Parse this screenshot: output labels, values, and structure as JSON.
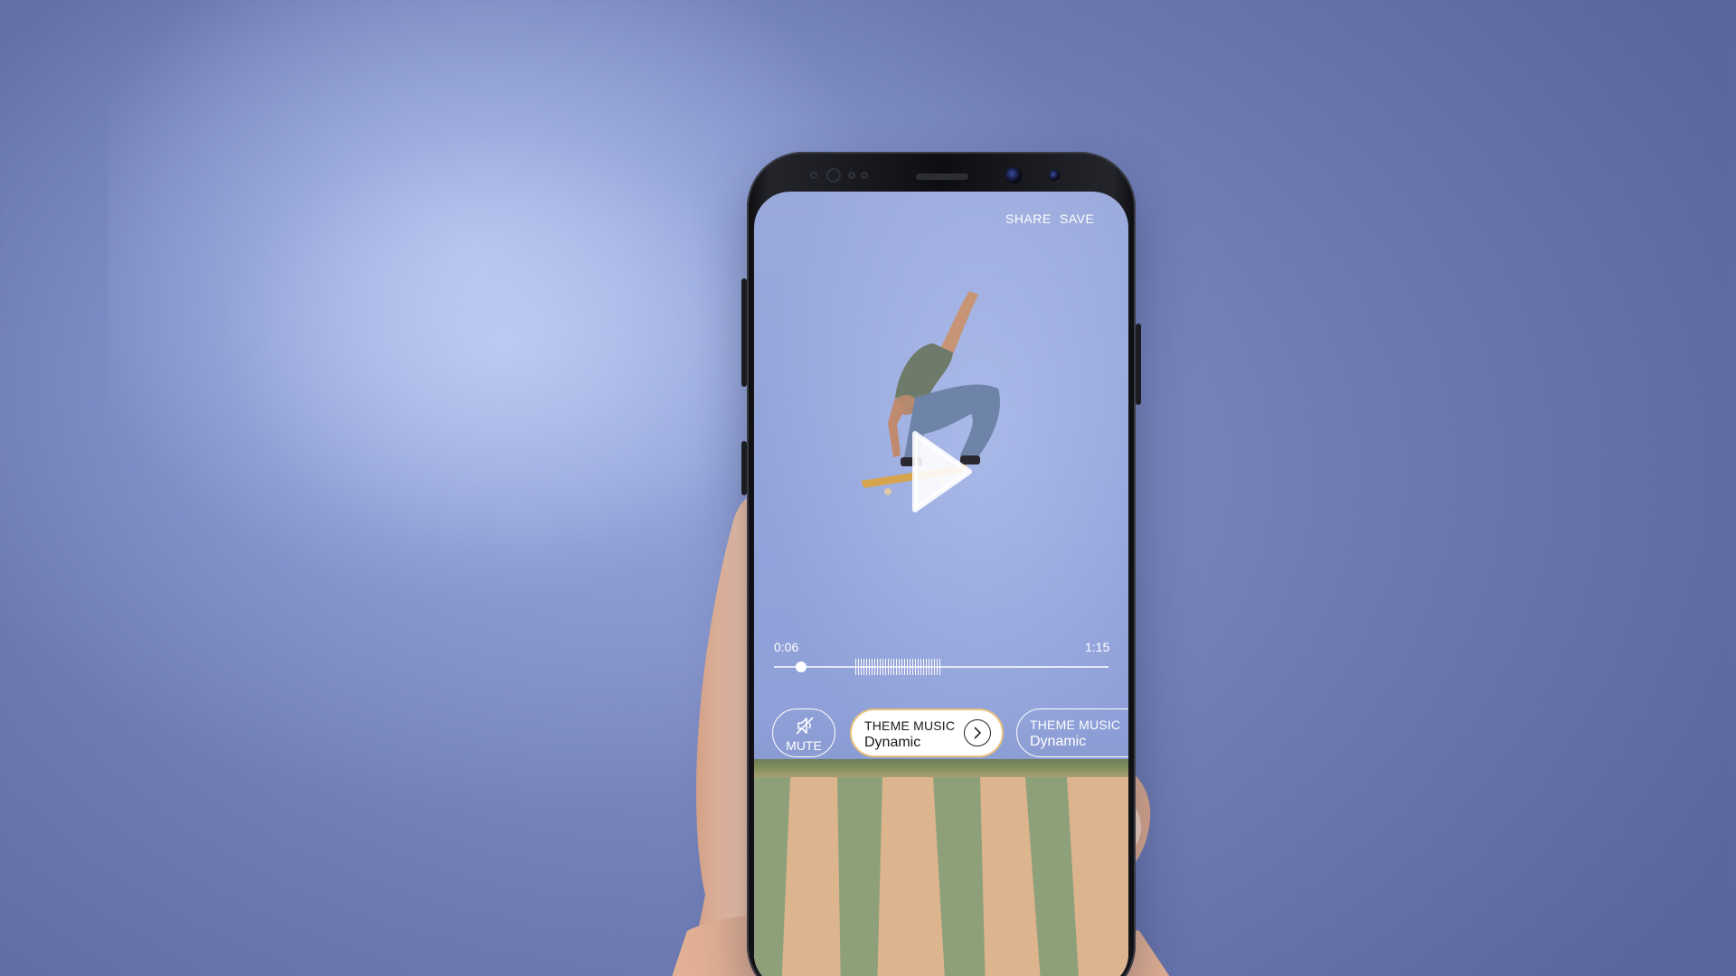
{
  "video_editor": {
    "actions": {
      "share_label": "SHARE",
      "save_label": "SAVE"
    },
    "playback": {
      "current_time": "0:06",
      "total_time": "1:15",
      "progress_fraction": 0.08
    },
    "controls": {
      "mute_label": "MUTE",
      "theme_options": [
        {
          "title": "THEME MUSIC",
          "subtitle": "Dynamic",
          "selected": true
        },
        {
          "title": "THEME MUSIC",
          "subtitle": "Dynamic",
          "selected": false
        }
      ]
    },
    "icons": {
      "mute": "speaker-muted-icon",
      "play": "play-icon",
      "next": "chevron-right-icon"
    },
    "colors": {
      "accent_border": "#e8c27d",
      "overlay_text": "#ffffff"
    }
  }
}
